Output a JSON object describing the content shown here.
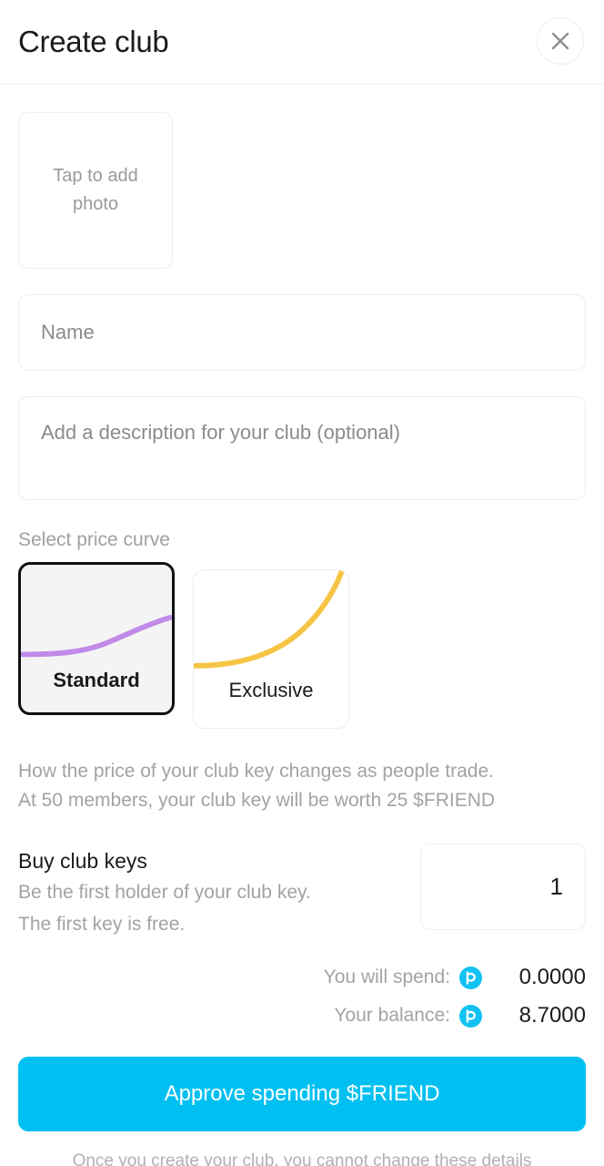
{
  "header": {
    "title": "Create club",
    "close_icon": "close-icon"
  },
  "photo": {
    "label": "Tap to add photo"
  },
  "form": {
    "name_placeholder": "Name",
    "name_value": "",
    "description_placeholder": "Add a description for your club (optional)",
    "description_value": ""
  },
  "price_curve": {
    "label": "Select price curve",
    "options": [
      {
        "label": "Standard",
        "selected": true,
        "color": "#c08ae8"
      },
      {
        "label": "Exclusive",
        "selected": false,
        "color": "#f6c445"
      }
    ],
    "note_line1": "How the price of your club key changes as people trade.",
    "note_line2": "At 50 members, your club key will be worth 25 $FRIEND"
  },
  "buy": {
    "title": "Buy club keys",
    "sub_line1": "Be the first holder of your club key.",
    "sub_line2": "The first key is free.",
    "quantity": "1"
  },
  "summary": {
    "spend_label": "You will spend:",
    "spend_value": "0.0000",
    "balance_label": "Your balance:",
    "balance_value": "8.7000",
    "coin_icon": "friend-token-icon",
    "coin_color": "#12c2f3"
  },
  "cta": {
    "label": "Approve spending $FRIEND",
    "color": "#00c0f2"
  },
  "footnote": "Once you create your club, you cannot change these details"
}
